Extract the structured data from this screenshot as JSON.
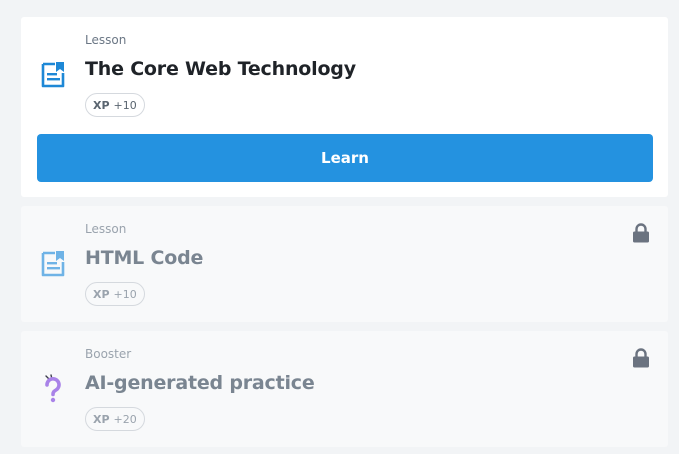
{
  "cards": [
    {
      "kind": "Lesson",
      "title": "The Core Web Technology",
      "xp_label": "XP",
      "xp_value": "+10",
      "icon": "lesson-document-icon",
      "button_label": "Learn",
      "locked": false
    },
    {
      "kind": "Lesson",
      "title": "HTML Code",
      "xp_label": "XP",
      "xp_value": "+10",
      "icon": "lesson-document-icon",
      "locked": true
    },
    {
      "kind": "Booster",
      "title": "AI-generated practice",
      "xp_label": "XP",
      "xp_value": "+20",
      "icon": "question-mark-icon",
      "locked": true
    }
  ],
  "colors": {
    "accent": "#2492e0",
    "icon_blue": "#1e88d6",
    "icon_blue_muted": "#6fb3e6",
    "booster_purple": "#a983e8",
    "lock_gray": "#6b7380"
  }
}
